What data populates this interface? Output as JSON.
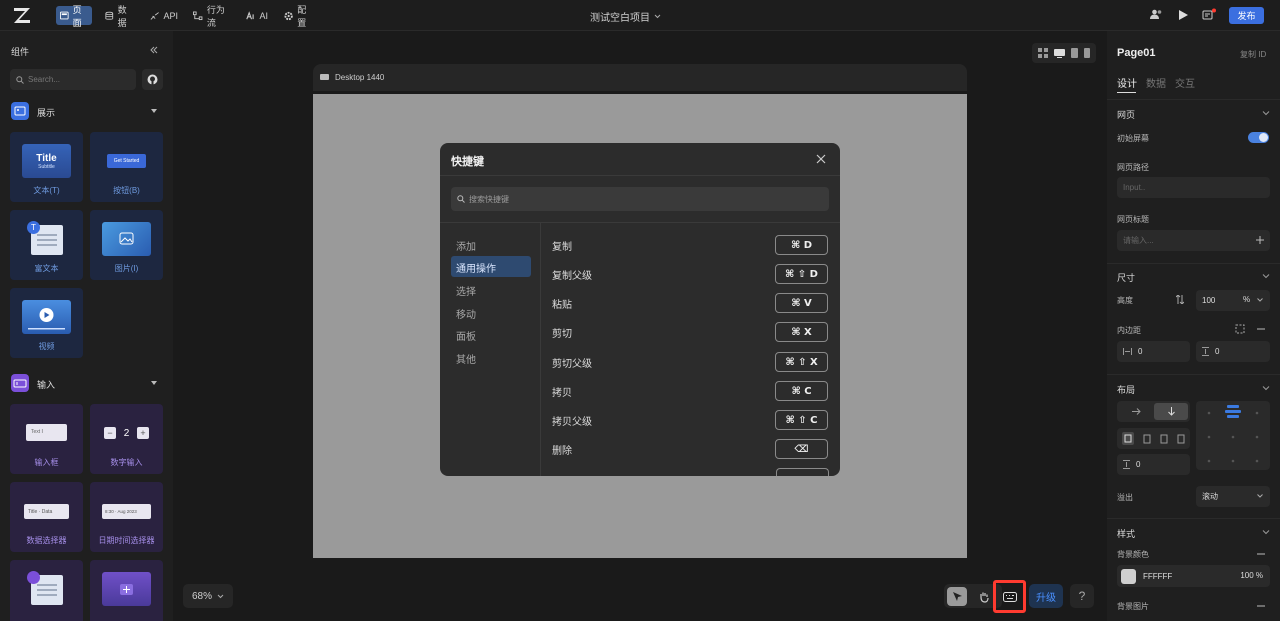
{
  "topbar": {
    "nav": [
      {
        "label": "页面",
        "icon": "page-icon"
      },
      {
        "label": "数据",
        "icon": "data-icon"
      },
      {
        "label": "API",
        "icon": "api-icon"
      },
      {
        "label": "行为流",
        "icon": "flow-icon"
      },
      {
        "label": "AI",
        "icon": "ai-icon"
      },
      {
        "label": "配置",
        "icon": "gear-icon"
      }
    ],
    "project_title": "测试空白项目",
    "publish_label": "发布"
  },
  "left": {
    "title": "组件",
    "search_placeholder": "Search...",
    "display_section": "展示",
    "display_items": [
      "文本(T)",
      "按钮(B)",
      "富文本",
      "图片(I)",
      "视频"
    ],
    "title_thumb": "Title",
    "subtitle_thumb": "Subtitle",
    "button_thumb": "Get Started",
    "input_section": "输入",
    "input_items": [
      "输入框",
      "数字输入",
      "数据选择器",
      "日期时间选择器"
    ],
    "input_thumb": "Text",
    "stepper_value": "2",
    "select_thumb": "Title · Data",
    "date_thumb": "8:30 · Aug 2023"
  },
  "canvas": {
    "device_label": "Desktop 1440",
    "zoom": "68%",
    "upgrade_label": "升级",
    "help_label": "?"
  },
  "modal": {
    "title": "快捷键",
    "search_placeholder": "搜索快捷键",
    "categories": [
      "添加",
      "通用操作",
      "选择",
      "移动",
      "面板",
      "其他"
    ],
    "active_category": "通用操作",
    "shortcuts": [
      {
        "name": "复制",
        "keys": "⌘ D"
      },
      {
        "name": "复制父级",
        "keys": "⌘ ⇧ D"
      },
      {
        "name": "粘贴",
        "keys": "⌘ V"
      },
      {
        "name": "剪切",
        "keys": "⌘ X"
      },
      {
        "name": "剪切父级",
        "keys": "⌘ ⇧ X"
      },
      {
        "name": "拷贝",
        "keys": "⌘ C"
      },
      {
        "name": "拷贝父级",
        "keys": "⌘ ⇧ C"
      },
      {
        "name": "删除",
        "keys": "⌫"
      }
    ]
  },
  "right": {
    "page_name": "Page01",
    "copy_id": "复制 ID",
    "tabs": [
      "设计",
      "数据",
      "交互"
    ],
    "webpage_section": "网页",
    "initial_screen": "初始屏幕",
    "path_label": "网页路径",
    "path_placeholder": "Input..",
    "page_title_label": "网页标题",
    "page_title_placeholder": "请输入...",
    "size_section": "尺寸",
    "height_label": "高度",
    "height_value": "100",
    "height_unit": "%",
    "padding_label": "内边距",
    "padding_h": "0",
    "padding_v": "0",
    "layout_section": "布局",
    "gap_value": "0",
    "overflow_label": "溢出",
    "overflow_value": "滚动",
    "style_section": "样式",
    "bg_color_label": "背景颜色",
    "bg_color_value": "FFFFFF",
    "bg_opacity": "100 %",
    "bg_image_label": "背景图片"
  },
  "colors": {
    "accent": "#3b6fe0",
    "highlight": "#ff3b30"
  }
}
